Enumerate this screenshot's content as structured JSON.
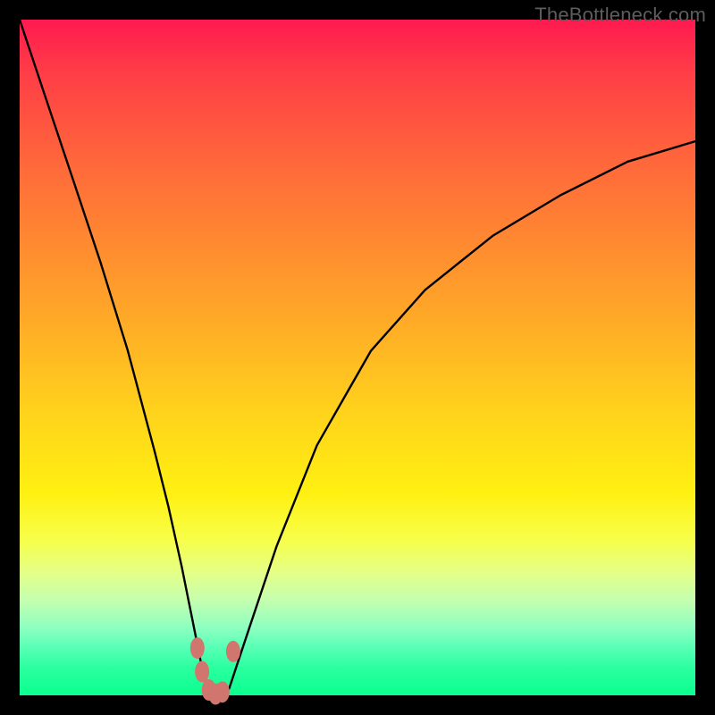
{
  "attribution": "TheBottleneck.com",
  "chart_data": {
    "type": "line",
    "title": "",
    "xlabel": "",
    "ylabel": "",
    "xlim": [
      0,
      100
    ],
    "ylim": [
      0,
      100
    ],
    "notes": "V-shaped bottleneck curve; minimum (~0%) near x≈29. Values estimated from plot pixels; no axis tick labels present.",
    "series": [
      {
        "name": "bottleneck-curve",
        "x": [
          0,
          4,
          8,
          12,
          16,
          20,
          22,
          24,
          26,
          27,
          28,
          29,
          30,
          31,
          32,
          34,
          38,
          44,
          52,
          60,
          70,
          80,
          90,
          100
        ],
        "values": [
          100,
          88,
          76,
          64,
          51,
          36,
          28,
          19,
          9,
          4,
          1,
          0,
          0,
          1,
          4,
          10,
          22,
          37,
          51,
          60,
          68,
          74,
          79,
          82
        ]
      }
    ],
    "markers": [
      {
        "name": "marker-left-1",
        "x": 26.3,
        "y": 7.0
      },
      {
        "name": "marker-left-2",
        "x": 27.0,
        "y": 3.5
      },
      {
        "name": "marker-bottom-1",
        "x": 28.0,
        "y": 0.8
      },
      {
        "name": "marker-bottom-2",
        "x": 29.0,
        "y": 0.2
      },
      {
        "name": "marker-bottom-3",
        "x": 30.0,
        "y": 0.5
      },
      {
        "name": "marker-right-1",
        "x": 31.6,
        "y": 6.5
      }
    ],
    "colors": {
      "curve": "#000000",
      "markers": "#d1756f",
      "gradient_top": "#ff1a50",
      "gradient_mid": "#ffd21c",
      "gradient_bottom": "#0aff8e",
      "frame": "#000000",
      "attribution_text": "#5d5d5d"
    }
  }
}
